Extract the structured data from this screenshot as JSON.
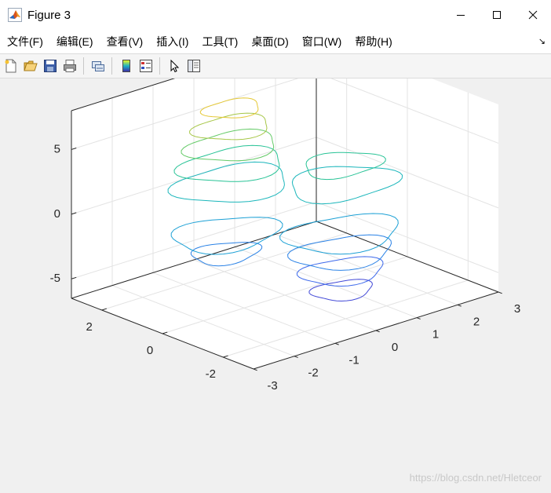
{
  "window": {
    "title": "Figure 3",
    "controls": [
      "minimize",
      "maximize",
      "close"
    ]
  },
  "menu": [
    "文件(F)",
    "编辑(E)",
    "查看(V)",
    "插入(I)",
    "工具(T)",
    "桌面(D)",
    "窗口(W)",
    "帮助(H)"
  ],
  "toolbar": {
    "icons": [
      "new-figure-icon",
      "open-file-icon",
      "save-icon",
      "print-icon",
      "link-plot-icon",
      "colorbar-icon",
      "legend-icon",
      "pointer-icon",
      "property-editor-icon"
    ]
  },
  "chart_data": {
    "type": "contour3",
    "title": "",
    "xlabel": "",
    "ylabel": "",
    "zlabel": "",
    "xlim": [
      -3,
      3
    ],
    "ylim": [
      -3,
      3
    ],
    "zlim": [
      -6.5,
      8
    ],
    "x_ticks": [
      -3,
      -2,
      -1,
      0,
      1,
      2,
      3
    ],
    "y_ticks": [
      -2,
      0,
      2
    ],
    "z_ticks": [
      -5,
      0,
      5
    ],
    "grid": true,
    "colormap": "parula",
    "peaks": [
      {
        "x": -0.1,
        "y": 1.6,
        "z": 8.1,
        "sign": "max"
      },
      {
        "x": 0.3,
        "y": -1.5,
        "z": -6.5,
        "sign": "min"
      },
      {
        "x": -1.3,
        "y": 0.2,
        "z": -3.0,
        "sign": "min"
      },
      {
        "x": 1.4,
        "y": 0.0,
        "z": 3.6,
        "sign": "max"
      }
    ],
    "watermark": "https://blog.csdn.net/Hletceor"
  }
}
